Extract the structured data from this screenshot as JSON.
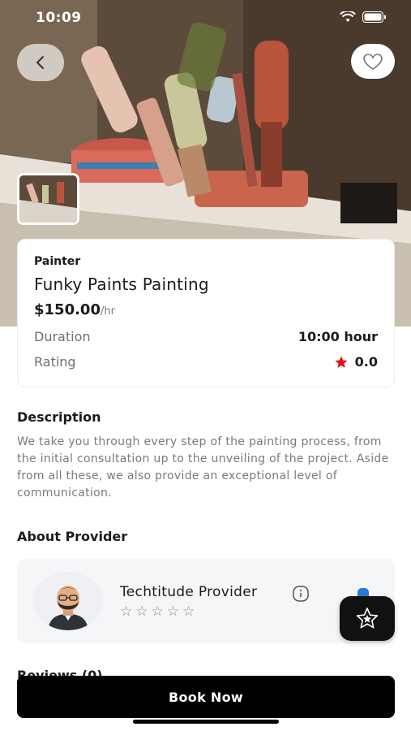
{
  "status_bar": {
    "time": "10:09"
  },
  "hero": {
    "image_description_icon": "paint-brushes-photo"
  },
  "service": {
    "category": "Painter",
    "name": "Funky Paints Painting",
    "price": "$150.00",
    "price_unit": "/hr",
    "duration_label": "Duration",
    "duration_value": "10:00 hour",
    "rating_label": "Rating",
    "rating_value": "0.0"
  },
  "description": {
    "title": "Description",
    "text": "We take you through every step of the painting process, from the initial consultation up to the unveiling of the project. Aside from all these, we also provide an exceptional level of communication."
  },
  "provider": {
    "title": "About Provider",
    "name": "Techtitude Provider",
    "stars": [
      "☆",
      "☆",
      "☆",
      "☆",
      "☆"
    ]
  },
  "reviews": {
    "title": "Reviews (0)"
  },
  "actions": {
    "book_label": "Book Now"
  },
  "colors": {
    "accent": "#000000",
    "star_red": "#e0121c",
    "card_bg": "#f5f6f8"
  }
}
